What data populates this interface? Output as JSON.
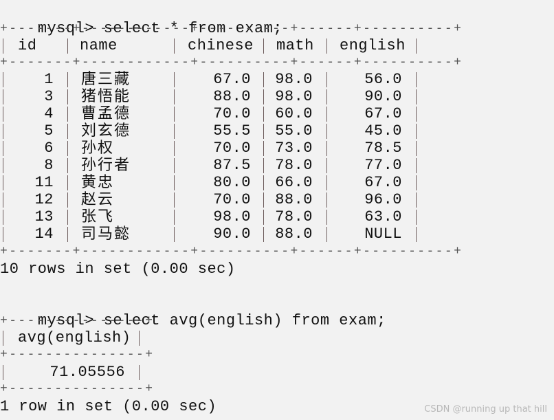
{
  "query1": {
    "prompt": "mysql>",
    "command": "select * from exam;",
    "columns": [
      "id",
      "name",
      "chinese",
      "math",
      "english"
    ],
    "rows": [
      {
        "id": "1",
        "name": "唐三藏",
        "chinese": "67.0",
        "math": "98.0",
        "english": "56.0"
      },
      {
        "id": "3",
        "name": "猪悟能",
        "chinese": "88.0",
        "math": "98.0",
        "english": "90.0"
      },
      {
        "id": "4",
        "name": "曹孟德",
        "chinese": "70.0",
        "math": "60.0",
        "english": "67.0"
      },
      {
        "id": "5",
        "name": "刘玄德",
        "chinese": "55.5",
        "math": "55.0",
        "english": "45.0"
      },
      {
        "id": "6",
        "name": "孙权",
        "chinese": "70.0",
        "math": "73.0",
        "english": "78.5"
      },
      {
        "id": "8",
        "name": "孙行者",
        "chinese": "87.5",
        "math": "78.0",
        "english": "77.0"
      },
      {
        "id": "11",
        "name": "黄忠",
        "chinese": "80.0",
        "math": "66.0",
        "english": "67.0"
      },
      {
        "id": "12",
        "name": "赵云",
        "chinese": "70.0",
        "math": "88.0",
        "english": "96.0"
      },
      {
        "id": "13",
        "name": "张飞",
        "chinese": "98.0",
        "math": "78.0",
        "english": "63.0"
      },
      {
        "id": "14",
        "name": "司马懿",
        "chinese": "90.0",
        "math": "88.0",
        "english": "NULL"
      }
    ],
    "border": "+-------+------------+----------+------+----------+",
    "summary": "10 rows in set (0.00 sec)"
  },
  "query2": {
    "prompt": "mysql>",
    "command": "select avg(english) from exam;",
    "column": "avg(english)",
    "value": "71.05556",
    "border": "+---------------+",
    "summary": "1 row in set (0.00 sec)"
  },
  "watermark": "CSDN @running up that hill"
}
